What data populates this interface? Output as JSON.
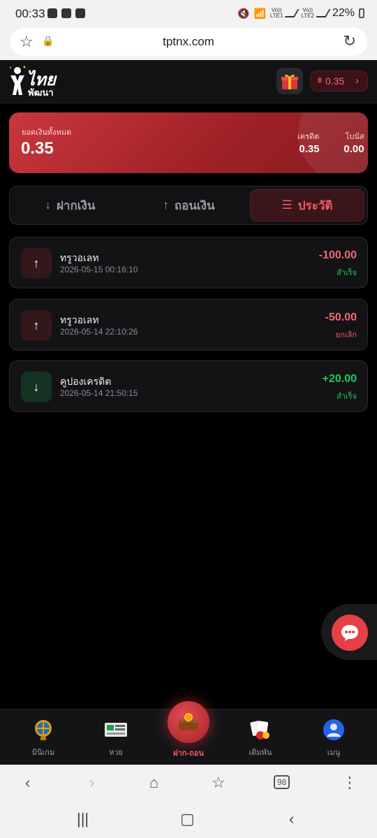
{
  "status_bar": {
    "time": "00:33",
    "net1_top": "Vo))",
    "net1_bottom": "LTE1",
    "net2_top": "Vo))",
    "net2_bottom": "LTE2",
    "battery": "22%"
  },
  "browser": {
    "url": "tptnx.com",
    "tabs_count": "98"
  },
  "header": {
    "logo_line1": "ไทย",
    "logo_line2": "พัฒนา",
    "balance_currency": "฿",
    "balance_amount": "0.35"
  },
  "balance_card": {
    "total_label": "ยอดเงินทั้งหมด",
    "total_value": "0.35",
    "credit_label": "เครดิต",
    "credit_value": "0.35",
    "bonus_label": "โบนัส",
    "bonus_value": "0.00"
  },
  "tabs": {
    "deposit": "ฝากเงิน",
    "withdraw": "ถอนเงิน",
    "history": "ประวัติ"
  },
  "transactions": [
    {
      "title": "ทรูวอเลท",
      "date": "2026-05-15 00:16:10",
      "amount": "-100.00",
      "status": "สำเร็จ",
      "direction": "out",
      "amount_color": "#f26a73",
      "status_color": "#22c55e"
    },
    {
      "title": "ทรูวอเลท",
      "date": "2026-05-14 22:10:26",
      "amount": "-50.00",
      "status": "ยกเลิก",
      "direction": "out",
      "amount_color": "#f26a73",
      "status_color": "#f05a63"
    },
    {
      "title": "คูปองเครดิต",
      "date": "2026-05-14 21:50:15",
      "amount": "+20.00",
      "status": "สำเร็จ",
      "direction": "in",
      "amount_color": "#22c55e",
      "status_color": "#22c55e"
    }
  ],
  "bottom_nav": {
    "minigame": "มินิเกม",
    "lottery": "หวย",
    "deposit_withdraw": "ฝาก-ถอน",
    "betting": "เดิมพัน",
    "menu": "เมนู"
  }
}
